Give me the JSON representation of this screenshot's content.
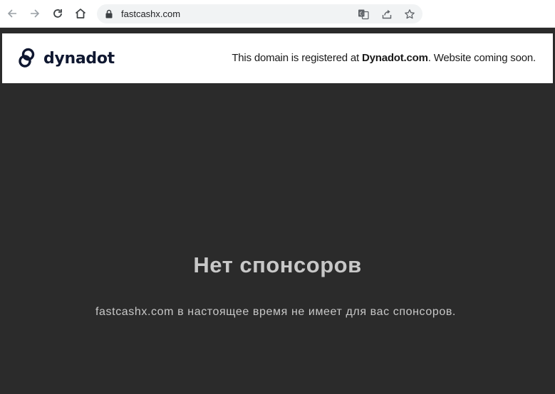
{
  "browser": {
    "url": "fastcashx.com",
    "icons": [
      "back-arrow-icon",
      "forward-arrow-icon",
      "reload-icon",
      "home-icon",
      "lock-icon",
      "translate-icon",
      "share-icon",
      "star-icon"
    ]
  },
  "banner": {
    "logo_text": "dynadot",
    "notice_prefix": "This domain is registered at ",
    "notice_brand": "Dynadot.com",
    "notice_suffix": ". Website coming soon."
  },
  "main": {
    "headline": "Нет спонсоров",
    "description": "fastcashx.com в настоящее время не имеет для вас спонсоров."
  },
  "colors": {
    "page_background": "#2b2b2b",
    "text_gray": "#c8c8c8",
    "logo_navy": "#0f1730"
  }
}
